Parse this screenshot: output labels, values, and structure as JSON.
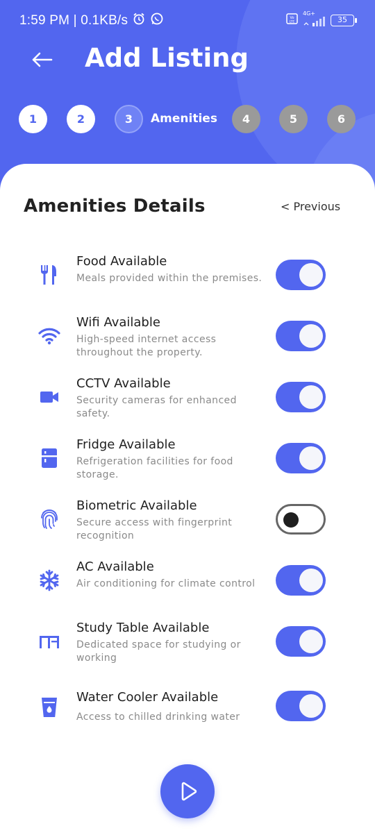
{
  "status_bar": {
    "left_text": "1:59 PM | 0.1KB/s",
    "network_label": "4G+",
    "battery": "35"
  },
  "header": {
    "title": "Add Listing"
  },
  "stepper": {
    "steps": [
      "1",
      "2",
      "3",
      "4",
      "5",
      "6"
    ],
    "current_label": "Amenities"
  },
  "section": {
    "title": "Amenities Details",
    "previous_label": "< Previous"
  },
  "amenities": [
    {
      "title": "Food Available",
      "desc": "Meals provided within the premises.",
      "enabled": true,
      "icon": "food-icon"
    },
    {
      "title": "Wifi Available",
      "desc": "High-speed internet access throughout the property.",
      "enabled": true,
      "icon": "wifi-icon"
    },
    {
      "title": "CCTV Available",
      "desc": "Security cameras for enhanced safety.",
      "enabled": true,
      "icon": "camera-icon"
    },
    {
      "title": "Fridge Available",
      "desc": "Refrigeration facilities for food storage.",
      "enabled": true,
      "icon": "fridge-icon"
    },
    {
      "title": "Biometric Available",
      "desc": "Secure access with fingerprint recognition",
      "enabled": false,
      "icon": "fingerprint-icon"
    },
    {
      "title": "AC Available",
      "desc": "Air conditioning for climate control",
      "enabled": true,
      "icon": "snowflake-icon"
    },
    {
      "title": "Study Table Available",
      "desc": "Dedicated space for studying or working",
      "enabled": true,
      "icon": "desk-icon"
    },
    {
      "title": "Water Cooler Available",
      "desc": "Access to chilled drinking water",
      "enabled": true,
      "icon": "water-glass-icon"
    }
  ],
  "colors": {
    "primary": "#5266ef",
    "pending_step": "#9a9a9a"
  }
}
